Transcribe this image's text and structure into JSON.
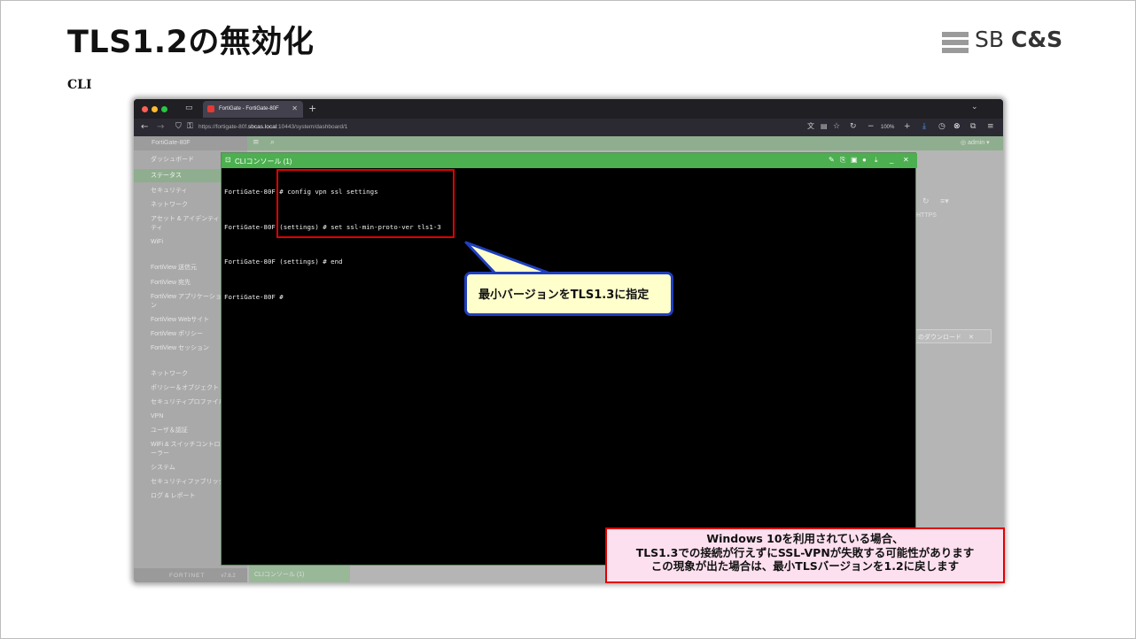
{
  "slide": {
    "title": "TLS1.2の無効化",
    "subtitle": "CLI",
    "logo": {
      "prefix": "SB",
      "brand": "C&S"
    }
  },
  "browser": {
    "tab_title": "FortiGate - FortiGate-80F",
    "url_prefix": "https://fortigate-80f.",
    "url_host": "sbcas.local",
    "url_suffix": ":10443/system/dashboard/1",
    "zoom": "100%"
  },
  "fortigate": {
    "device_name": "FortiGate-80F",
    "user": "admin",
    "version": "v7.6.2",
    "brand_footer": "FORTINET",
    "sidebar": [
      {
        "label": "ダッシュボード",
        "type": "section"
      },
      {
        "label": "ステータス",
        "type": "active"
      },
      {
        "label": "セキュリティ",
        "type": "child"
      },
      {
        "label": "ネットワーク",
        "type": "child"
      },
      {
        "label": "アセット & アイデンティティ",
        "type": "child"
      },
      {
        "label": "WiFi",
        "type": "child"
      },
      {
        "label": "FortiView 送信元",
        "type": "child"
      },
      {
        "label": "FortiView 宛先",
        "type": "child"
      },
      {
        "label": "FortiView アプリケーション",
        "type": "child"
      },
      {
        "label": "FortiView Webサイト",
        "type": "child"
      },
      {
        "label": "FortiView ポリシー",
        "type": "child"
      },
      {
        "label": "FortiView セッション",
        "type": "child"
      },
      {
        "label": "ネットワーク",
        "type": "section"
      },
      {
        "label": "ポリシー＆オブジェクト",
        "type": "section"
      },
      {
        "label": "セキュリティプロファイル",
        "type": "section"
      },
      {
        "label": "VPN",
        "type": "section"
      },
      {
        "label": "ユーザ＆認証",
        "type": "section"
      },
      {
        "label": "WiFi & スイッチコントローラー",
        "type": "section"
      },
      {
        "label": "システム",
        "type": "section"
      },
      {
        "label": "セキュリティファブリック",
        "type": "section"
      },
      {
        "label": "ログ & レポート",
        "type": "section"
      }
    ],
    "bg_https": "HTTPS",
    "bg_download": "のダウンロード",
    "bottom_tab": "CLIコンソール (1)"
  },
  "console": {
    "title": "CLIコンソール (1)",
    "lines": [
      "FortiGate-80F # config vpn ssl settings",
      "FortiGate-80F (settings) # set ssl-min-proto-ver tls1-3",
      "FortiGate-80F (settings) # end",
      "FortiGate-80F #"
    ]
  },
  "callout": "最小バージョンをTLS1.3に指定",
  "note": {
    "line1": "Windows 10を利用されている場合、",
    "line2": "TLS1.3での接続が行えずにSSL-VPNが失敗する可能性があります",
    "line3": "この現象が出た場合は、最小TLSバージョンを1.2に戻します"
  },
  "colors": {
    "console_header": "#4caf50",
    "callout_border": "#1f3fbf",
    "callout_fill": "#ffffcc",
    "alert_red": "#e00000",
    "note_fill": "#fde0ef"
  }
}
